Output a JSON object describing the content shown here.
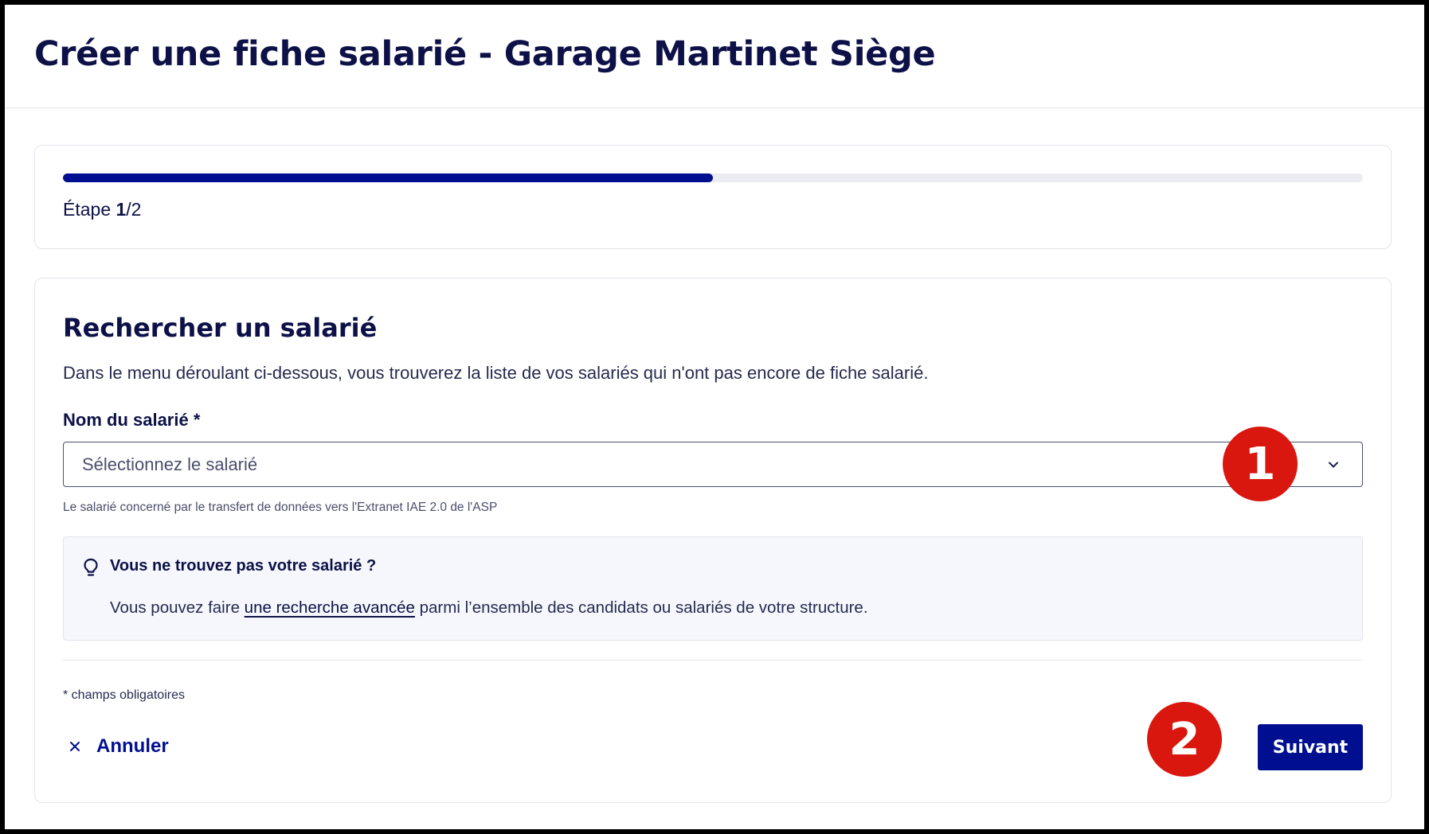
{
  "header": {
    "title": "Créer une fiche salarié - Garage Martinet Siège"
  },
  "progress": {
    "fraction": 0.5,
    "step_prefix": "Étape ",
    "step_current": "1",
    "step_total": "/2"
  },
  "form": {
    "section_title": "Rechercher un salarié",
    "description": "Dans le menu déroulant ci-dessous, vous trouverez la liste de vos salariés qui n'ont pas encore de fiche salarié.",
    "field_label": "Nom du salarié *",
    "select_placeholder": "Sélectionnez le salarié",
    "help_text": "Le salarié concerné par le transfert de données vers l'Extranet IAE 2.0 de l'ASP",
    "info": {
      "title": "Vous ne trouvez pas votre salarié ?",
      "text_before": "Vous pouvez faire ",
      "link": "une recherche avancée",
      "text_after": " parmi l’ensemble des candidats ou salariés de votre structure."
    },
    "required_note": "* champs obligatoires",
    "cancel_label": "Annuler",
    "next_label": "Suivant"
  },
  "annotations": {
    "badge_1": "1",
    "badge_2": "2"
  },
  "colors": {
    "primary": "#000f8f",
    "badge": "#d9170f",
    "text": "#0d1147"
  },
  "icons": {
    "cancel": "close-icon",
    "select": "chevron-down-icon",
    "info": "lightbulb-icon"
  }
}
